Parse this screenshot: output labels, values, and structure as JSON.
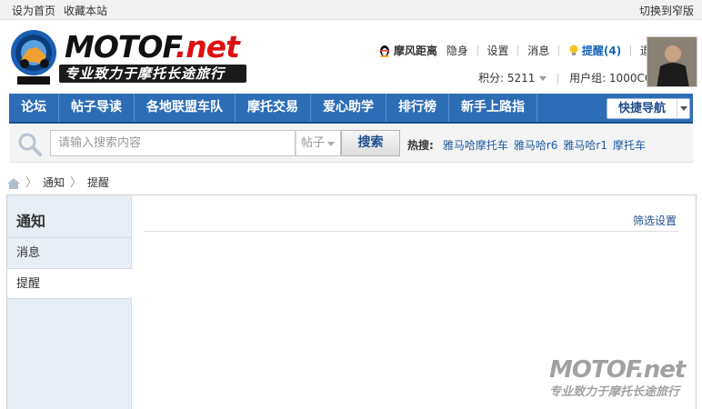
{
  "topbar": {
    "set_home": "设为首页",
    "bookmark": "收藏本站",
    "switch_width": "切换到窄版"
  },
  "logo": {
    "word_main": "MOTOF",
    "word_ext": ".net",
    "slogan": "专业致力于摩托长途旅行"
  },
  "user": {
    "username": "摩风距离",
    "invisible": "隐身",
    "settings": "设置",
    "messages": "消息",
    "remind": "提醒(4)",
    "logout": "退出",
    "points": "积分: 5211",
    "group": "用户组: 1000CC"
  },
  "nav": {
    "items": [
      "论坛",
      "帖子导读",
      "各地联盟车队",
      "摩托交易",
      "爱心助学",
      "排行榜",
      "新手上路指"
    ],
    "quick_nav": "快捷导航"
  },
  "search": {
    "placeholder": "请输入搜索内容",
    "type": "帖子",
    "button": "搜索",
    "hot_label": "热搜:",
    "hot_links": [
      "雅马哈摩托车",
      "雅马哈r6",
      "雅马哈r1",
      "摩托车"
    ]
  },
  "breadcrumb": {
    "items": [
      "通知",
      "提醒"
    ]
  },
  "sidebar": {
    "title": "通知",
    "items": [
      "消息",
      "提醒"
    ]
  },
  "main": {
    "filter": "筛选设置"
  },
  "watermark": {
    "word": "MOTOF.net",
    "slogan": "专业致力于摩托长途旅行"
  },
  "colors": {
    "nav_bg": "#2d6db6",
    "link": "#1f4e8c",
    "sidebar_bg": "#e7eef6"
  }
}
